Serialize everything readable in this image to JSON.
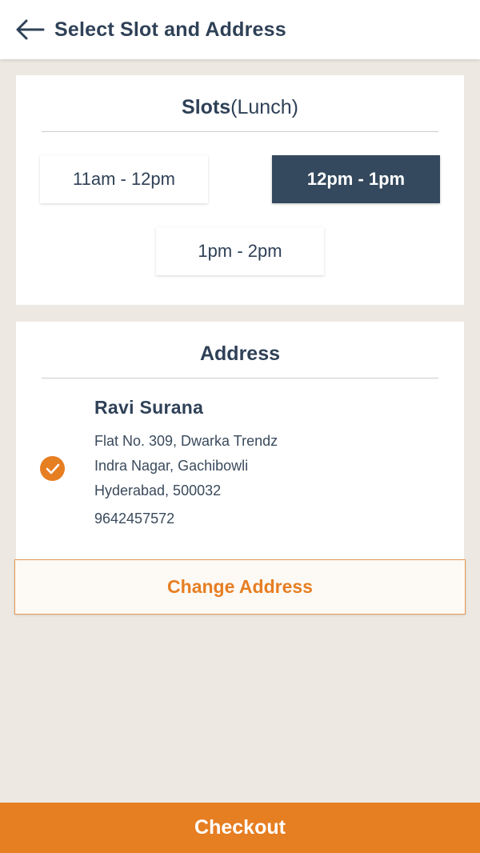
{
  "header": {
    "title": "Select Slot and Address",
    "back_icon": "arrow-left-icon"
  },
  "slots": {
    "heading": "Slots",
    "subheading": "(Lunch)",
    "options": [
      {
        "label": "11am - 12pm",
        "selected": false
      },
      {
        "label": "12pm - 1pm",
        "selected": true
      },
      {
        "label": "1pm - 2pm",
        "selected": false
      }
    ]
  },
  "address": {
    "heading": "Address",
    "name": "Ravi Surana",
    "line1": "Flat No. 309, Dwarka Trendz",
    "line2": "Indra Nagar, Gachibowli",
    "line3": "Hyderabad, 500032",
    "phone": "9642457572",
    "selected_icon": "check-circle-icon"
  },
  "actions": {
    "change_address": "Change Address",
    "checkout": "Checkout"
  },
  "colors": {
    "accent": "#e67e22",
    "primary_dark": "#34495e",
    "text": "#2f4157",
    "background": "#ede9e2"
  }
}
